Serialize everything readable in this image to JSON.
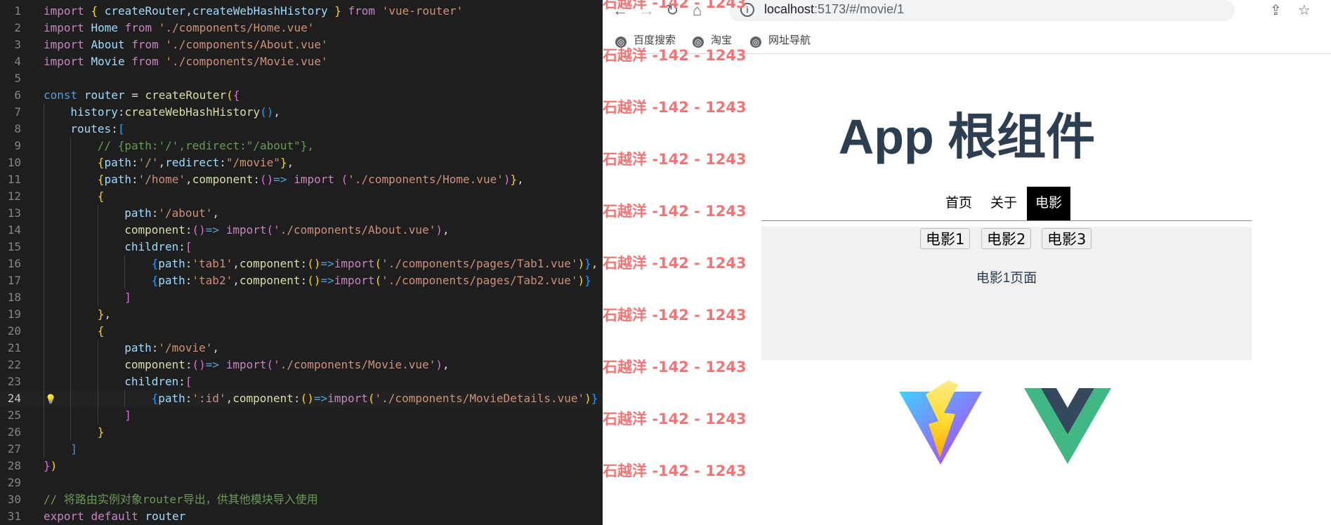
{
  "editor": {
    "active_line": 24,
    "lines": [
      {
        "n": 1,
        "indent": 0,
        "tokens": [
          [
            "kw",
            "import"
          ],
          [
            "pl",
            " "
          ],
          [
            "b1",
            "{"
          ],
          [
            "pl",
            " "
          ],
          [
            "id",
            "createRouter"
          ],
          [
            "pl",
            ","
          ],
          [
            "id",
            "createWebHashHistory"
          ],
          [
            "pl",
            " "
          ],
          [
            "b1",
            "}"
          ],
          [
            "pl",
            " "
          ],
          [
            "kw",
            "from"
          ],
          [
            "pl",
            " "
          ],
          [
            "str",
            "'vue-router'"
          ]
        ]
      },
      {
        "n": 2,
        "indent": 0,
        "tokens": [
          [
            "kw",
            "import"
          ],
          [
            "pl",
            " "
          ],
          [
            "id",
            "Home"
          ],
          [
            "pl",
            " "
          ],
          [
            "kw",
            "from"
          ],
          [
            "pl",
            " "
          ],
          [
            "str",
            "'./components/Home.vue'"
          ]
        ]
      },
      {
        "n": 3,
        "indent": 0,
        "tokens": [
          [
            "kw",
            "import"
          ],
          [
            "pl",
            " "
          ],
          [
            "id",
            "About"
          ],
          [
            "pl",
            " "
          ],
          [
            "kw",
            "from"
          ],
          [
            "pl",
            " "
          ],
          [
            "str",
            "'./components/About.vue'"
          ]
        ]
      },
      {
        "n": 4,
        "indent": 0,
        "tokens": [
          [
            "kw",
            "import"
          ],
          [
            "pl",
            " "
          ],
          [
            "id",
            "Movie"
          ],
          [
            "pl",
            " "
          ],
          [
            "kw",
            "from"
          ],
          [
            "pl",
            " "
          ],
          [
            "str",
            "'./components/Movie.vue'"
          ]
        ]
      },
      {
        "n": 5,
        "indent": 0,
        "tokens": []
      },
      {
        "n": 6,
        "indent": 0,
        "tokens": [
          [
            "kb",
            "const"
          ],
          [
            "pl",
            " "
          ],
          [
            "id",
            "router"
          ],
          [
            "pl",
            " = "
          ],
          [
            "fn",
            "createRouter"
          ],
          [
            "b1",
            "("
          ],
          [
            "b2",
            "{"
          ]
        ]
      },
      {
        "n": 7,
        "indent": 1,
        "tokens": [
          [
            "id",
            "history"
          ],
          [
            "pl",
            ":"
          ],
          [
            "fn",
            "createWebHashHistory"
          ],
          [
            "b3",
            "()"
          ],
          [
            "pl",
            ","
          ]
        ]
      },
      {
        "n": 8,
        "indent": 1,
        "tokens": [
          [
            "id",
            "routes"
          ],
          [
            "pl",
            ":"
          ],
          [
            "b3",
            "["
          ]
        ]
      },
      {
        "n": 9,
        "indent": 2,
        "tokens": [
          [
            "cm",
            "// {path:'/',redirect:\"/about\"},"
          ]
        ]
      },
      {
        "n": 10,
        "indent": 2,
        "tokens": [
          [
            "b1",
            "{"
          ],
          [
            "id",
            "path"
          ],
          [
            "pl",
            ":"
          ],
          [
            "str",
            "'/'"
          ],
          [
            "pl",
            ","
          ],
          [
            "id",
            "redirect"
          ],
          [
            "pl",
            ":"
          ],
          [
            "str",
            "\"/movie\""
          ],
          [
            "b1",
            "}"
          ],
          [
            "pl",
            ","
          ]
        ]
      },
      {
        "n": 11,
        "indent": 2,
        "tokens": [
          [
            "b1",
            "{"
          ],
          [
            "id",
            "path"
          ],
          [
            "pl",
            ":"
          ],
          [
            "str",
            "'/home'"
          ],
          [
            "pl",
            ","
          ],
          [
            "fn",
            "component"
          ],
          [
            "pl",
            ":"
          ],
          [
            "b2",
            "()"
          ],
          [
            "kb",
            "=>"
          ],
          [
            "pl",
            " "
          ],
          [
            "kw",
            "import"
          ],
          [
            "pl",
            " "
          ],
          [
            "b2",
            "("
          ],
          [
            "str",
            "'./components/Home.vue'"
          ],
          [
            "b2",
            ")"
          ],
          [
            "b1",
            "}"
          ],
          [
            "pl",
            ","
          ]
        ]
      },
      {
        "n": 12,
        "indent": 2,
        "tokens": [
          [
            "b1",
            "{"
          ]
        ]
      },
      {
        "n": 13,
        "indent": 3,
        "tokens": [
          [
            "id",
            "path"
          ],
          [
            "pl",
            ":"
          ],
          [
            "str",
            "'/about'"
          ],
          [
            "pl",
            ","
          ]
        ]
      },
      {
        "n": 14,
        "indent": 3,
        "tokens": [
          [
            "fn",
            "component"
          ],
          [
            "pl",
            ":"
          ],
          [
            "b2",
            "()"
          ],
          [
            "kb",
            "=>"
          ],
          [
            "pl",
            " "
          ],
          [
            "kw",
            "import"
          ],
          [
            "b2",
            "("
          ],
          [
            "str",
            "'./components/About.vue'"
          ],
          [
            "b2",
            ")"
          ],
          [
            "pl",
            ","
          ]
        ]
      },
      {
        "n": 15,
        "indent": 3,
        "tokens": [
          [
            "id",
            "children"
          ],
          [
            "pl",
            ":"
          ],
          [
            "b2",
            "["
          ]
        ]
      },
      {
        "n": 16,
        "indent": 4,
        "tokens": [
          [
            "b3",
            "{"
          ],
          [
            "id",
            "path"
          ],
          [
            "pl",
            ":"
          ],
          [
            "str",
            "'tab1'"
          ],
          [
            "pl",
            ","
          ],
          [
            "fn",
            "component"
          ],
          [
            "pl",
            ":"
          ],
          [
            "b1",
            "()"
          ],
          [
            "kb",
            "=>"
          ],
          [
            "kw",
            "import"
          ],
          [
            "b1",
            "("
          ],
          [
            "str",
            "'./components/pages/Tab1.vue'"
          ],
          [
            "b1",
            ")"
          ],
          [
            "b3",
            "}"
          ],
          [
            "pl",
            ","
          ]
        ]
      },
      {
        "n": 17,
        "indent": 4,
        "tokens": [
          [
            "b3",
            "{"
          ],
          [
            "id",
            "path"
          ],
          [
            "pl",
            ":"
          ],
          [
            "str",
            "'tab2'"
          ],
          [
            "pl",
            ","
          ],
          [
            "fn",
            "component"
          ],
          [
            "pl",
            ":"
          ],
          [
            "b1",
            "()"
          ],
          [
            "kb",
            "=>"
          ],
          [
            "kw",
            "import"
          ],
          [
            "b1",
            "("
          ],
          [
            "str",
            "'./components/pages/Tab2.vue'"
          ],
          [
            "b1",
            ")"
          ],
          [
            "b3",
            "}"
          ]
        ]
      },
      {
        "n": 18,
        "indent": 3,
        "tokens": [
          [
            "b2",
            "]"
          ]
        ]
      },
      {
        "n": 19,
        "indent": 2,
        "tokens": [
          [
            "b1",
            "}"
          ],
          [
            "pl",
            ","
          ]
        ]
      },
      {
        "n": 20,
        "indent": 2,
        "tokens": [
          [
            "b1",
            "{"
          ]
        ]
      },
      {
        "n": 21,
        "indent": 3,
        "tokens": [
          [
            "id",
            "path"
          ],
          [
            "pl",
            ":"
          ],
          [
            "str",
            "'/movie'"
          ],
          [
            "pl",
            ","
          ]
        ]
      },
      {
        "n": 22,
        "indent": 3,
        "tokens": [
          [
            "fn",
            "component"
          ],
          [
            "pl",
            ":"
          ],
          [
            "b2",
            "()"
          ],
          [
            "kb",
            "=>"
          ],
          [
            "pl",
            " "
          ],
          [
            "kw",
            "import"
          ],
          [
            "b2",
            "("
          ],
          [
            "str",
            "'./components/Movie.vue'"
          ],
          [
            "b2",
            ")"
          ],
          [
            "pl",
            ","
          ]
        ]
      },
      {
        "n": 23,
        "indent": 3,
        "tokens": [
          [
            "id",
            "children"
          ],
          [
            "pl",
            ":"
          ],
          [
            "b2",
            "["
          ]
        ]
      },
      {
        "n": 24,
        "indent": 4,
        "tokens": [
          [
            "b3",
            "{"
          ],
          [
            "id",
            "path"
          ],
          [
            "pl",
            ":"
          ],
          [
            "str",
            "':id'"
          ],
          [
            "pl",
            ","
          ],
          [
            "fn",
            "component"
          ],
          [
            "pl",
            ":"
          ],
          [
            "b1",
            "()"
          ],
          [
            "kb",
            "=>"
          ],
          [
            "kw",
            "import"
          ],
          [
            "b1",
            "("
          ],
          [
            "str",
            "'./components/MovieDetails.vue'"
          ],
          [
            "b1",
            ")"
          ],
          [
            "b3",
            "}"
          ]
        ]
      },
      {
        "n": 25,
        "indent": 3,
        "tokens": [
          [
            "b2",
            "]"
          ]
        ]
      },
      {
        "n": 26,
        "indent": 2,
        "tokens": [
          [
            "b1",
            "}"
          ]
        ]
      },
      {
        "n": 27,
        "indent": 1,
        "tokens": [
          [
            "b3",
            "]"
          ]
        ]
      },
      {
        "n": 28,
        "indent": 0,
        "tokens": [
          [
            "b2",
            "}"
          ],
          [
            "b1",
            ")"
          ]
        ]
      },
      {
        "n": 29,
        "indent": 0,
        "tokens": []
      },
      {
        "n": 30,
        "indent": 0,
        "tokens": [
          [
            "cm",
            "// 将路由实例对象router导出，供其他模块导入使用"
          ]
        ]
      },
      {
        "n": 31,
        "indent": 0,
        "tokens": [
          [
            "kw",
            "export"
          ],
          [
            "pl",
            " "
          ],
          [
            "kw",
            "default"
          ],
          [
            "pl",
            " "
          ],
          [
            "id",
            "router"
          ]
        ]
      }
    ]
  },
  "browser": {
    "url_host": "localhost",
    "url_rest": ":5173/#/movie/1",
    "bookmarks": [
      "百度搜索",
      "淘宝",
      "网址导航"
    ]
  },
  "app": {
    "title": "App 根组件",
    "nav": [
      "首页",
      "关于",
      "电影"
    ],
    "active_nav": 2,
    "movie_buttons": [
      "电影1",
      "电影2",
      "电影3"
    ],
    "detail_text": "电影1页面"
  },
  "watermark": "石越洋 -142 - 1243",
  "colors": {
    "editor_bg": "#1e1e1e",
    "title": "#2c3e50",
    "watermark": "#f27474"
  }
}
